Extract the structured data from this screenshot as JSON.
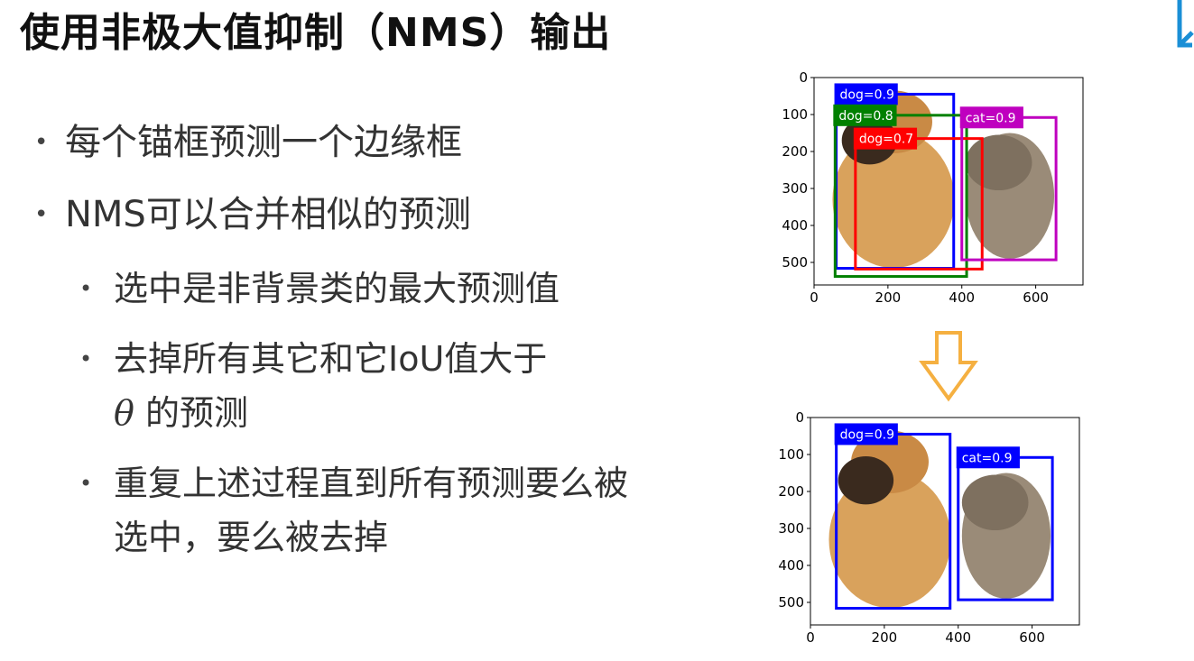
{
  "title": "使用非极大值抑制（NMS）输出",
  "bullets": [
    {
      "text": "每个锚框预测一个边缘框"
    },
    {
      "text": "NMS可以合并相似的预测"
    }
  ],
  "sub_bullets": [
    {
      "text": "选中是非背景类的最大预测值"
    },
    {
      "pre": "去掉所有其它和它IoU值大于",
      "symbol": "θ",
      "post": "的预测"
    },
    {
      "text": "重复上述过程直到所有预测要么被选中，要么被去掉"
    }
  ],
  "chart_data": [
    {
      "type": "image_with_boxes",
      "x_ticks": [
        0,
        200,
        400,
        600
      ],
      "y_ticks": [
        0,
        100,
        200,
        300,
        400,
        500
      ],
      "xlim": [
        0,
        728
      ],
      "ylim": [
        561,
        0
      ],
      "boxes": [
        {
          "label": "dog=0.9",
          "x0": 60,
          "y0": 45,
          "x1": 378,
          "y1": 516,
          "color": "#0000ff"
        },
        {
          "label": "dog=0.8",
          "x0": 57,
          "y0": 102,
          "x1": 413,
          "y1": 538,
          "color": "#008000"
        },
        {
          "label": "dog=0.7",
          "x0": 112,
          "y0": 165,
          "x1": 455,
          "y1": 518,
          "color": "#ff0000"
        },
        {
          "label": "cat=0.9",
          "x0": 400,
          "y0": 108,
          "x1": 655,
          "y1": 493,
          "color": "#bf00bf"
        }
      ]
    },
    {
      "type": "image_with_boxes",
      "x_ticks": [
        0,
        200,
        400,
        600
      ],
      "y_ticks": [
        0,
        100,
        200,
        300,
        400,
        500
      ],
      "xlim": [
        0,
        728
      ],
      "ylim": [
        561,
        0
      ],
      "boxes": [
        {
          "label": "dog=0.9",
          "x0": 70,
          "y0": 45,
          "x1": 378,
          "y1": 516,
          "color": "#0000ff"
        },
        {
          "label": "cat=0.9",
          "x0": 400,
          "y0": 108,
          "x1": 655,
          "y1": 493,
          "color": "#0000ff"
        }
      ]
    }
  ],
  "colors": {
    "arrow": "#f5b041",
    "corner": "#1a8fd6"
  }
}
